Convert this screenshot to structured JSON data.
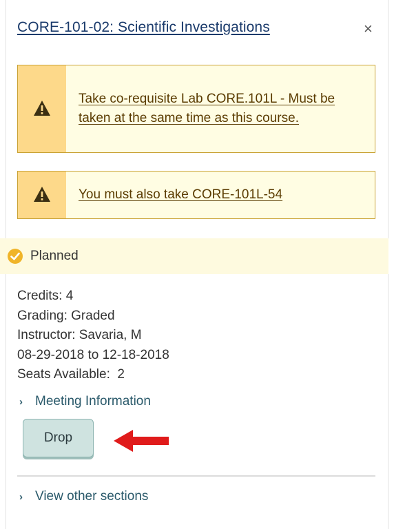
{
  "course": {
    "title": "CORE-101-02: Scientific Investigations",
    "close_glyph": "×"
  },
  "alerts": [
    {
      "icon": "warning-icon",
      "text": "Take co-requisite Lab CORE.101L - Must be taken at the same time as this course."
    },
    {
      "icon": "warning-icon",
      "text": "You must also take CORE-101L-54"
    }
  ],
  "status": {
    "icon": "check-circle-icon",
    "label": "Planned",
    "color": "#f0b429"
  },
  "details": {
    "credits": "Credits: 4",
    "grading": "Grading: Graded",
    "instructor": "Instructor: Savaria, M",
    "dates": "08-29-2018 to 12-18-2018",
    "seats": "Seats Available:  2"
  },
  "meeting_info": {
    "label": "Meeting Information",
    "icon": "chevron-right-icon"
  },
  "drop_button": {
    "label": "Drop"
  },
  "view_sections": {
    "label": "View other sections",
    "icon": "chevron-right-icon"
  },
  "annotation": {
    "icon": "red-arrow-icon",
    "color": "#e01b1b"
  }
}
